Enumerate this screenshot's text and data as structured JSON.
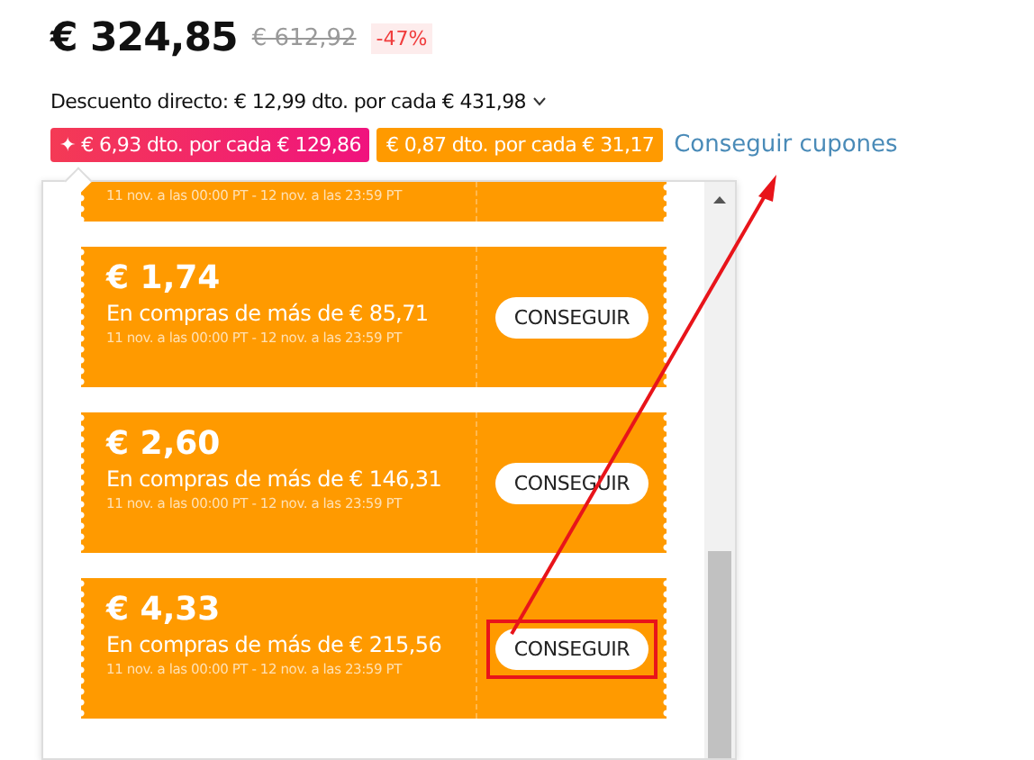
{
  "price": {
    "current": "€ 324,85",
    "original": "€ 612,92",
    "discount": "-47%"
  },
  "direct_discount": {
    "text": "Descuento directo: € 12,99 dto. por cada € 431,98",
    "expandable": true
  },
  "tags": [
    {
      "kind": "special",
      "icon": "✦",
      "text": "€ 6,93 dto. por cada € 129,86"
    },
    {
      "kind": "store",
      "text": "€ 0,87 dto. por cada € 31,17"
    }
  ],
  "get_coupons_link": "Conseguir cupones",
  "coupon_panel": {
    "coupons": [
      {
        "kind": "partial",
        "dates": "11 nov. a las 00:00 PT - 12 nov. a las 23:59 PT"
      },
      {
        "kind": "full",
        "amount": "€ 1,74",
        "condition": "En compras de más de € 85,71",
        "dates": "11 nov. a las 00:00 PT - 12 nov. a las 23:59 PT",
        "button": "CONSEGUIR",
        "highlighted": false
      },
      {
        "kind": "full",
        "amount": "€ 2,60",
        "condition": "En compras de más de € 146,31",
        "dates": "11 nov. a las 00:00 PT - 12 nov. a las 23:59 PT",
        "button": "CONSEGUIR",
        "highlighted": false
      },
      {
        "kind": "full",
        "amount": "€ 4,33",
        "condition": "En compras de más de € 215,56",
        "dates": "11 nov. a las 00:00 PT - 12 nov. a las 23:59 PT",
        "button": "CONSEGUIR",
        "highlighted": true
      }
    ]
  },
  "annotation": {
    "arrow": true
  }
}
